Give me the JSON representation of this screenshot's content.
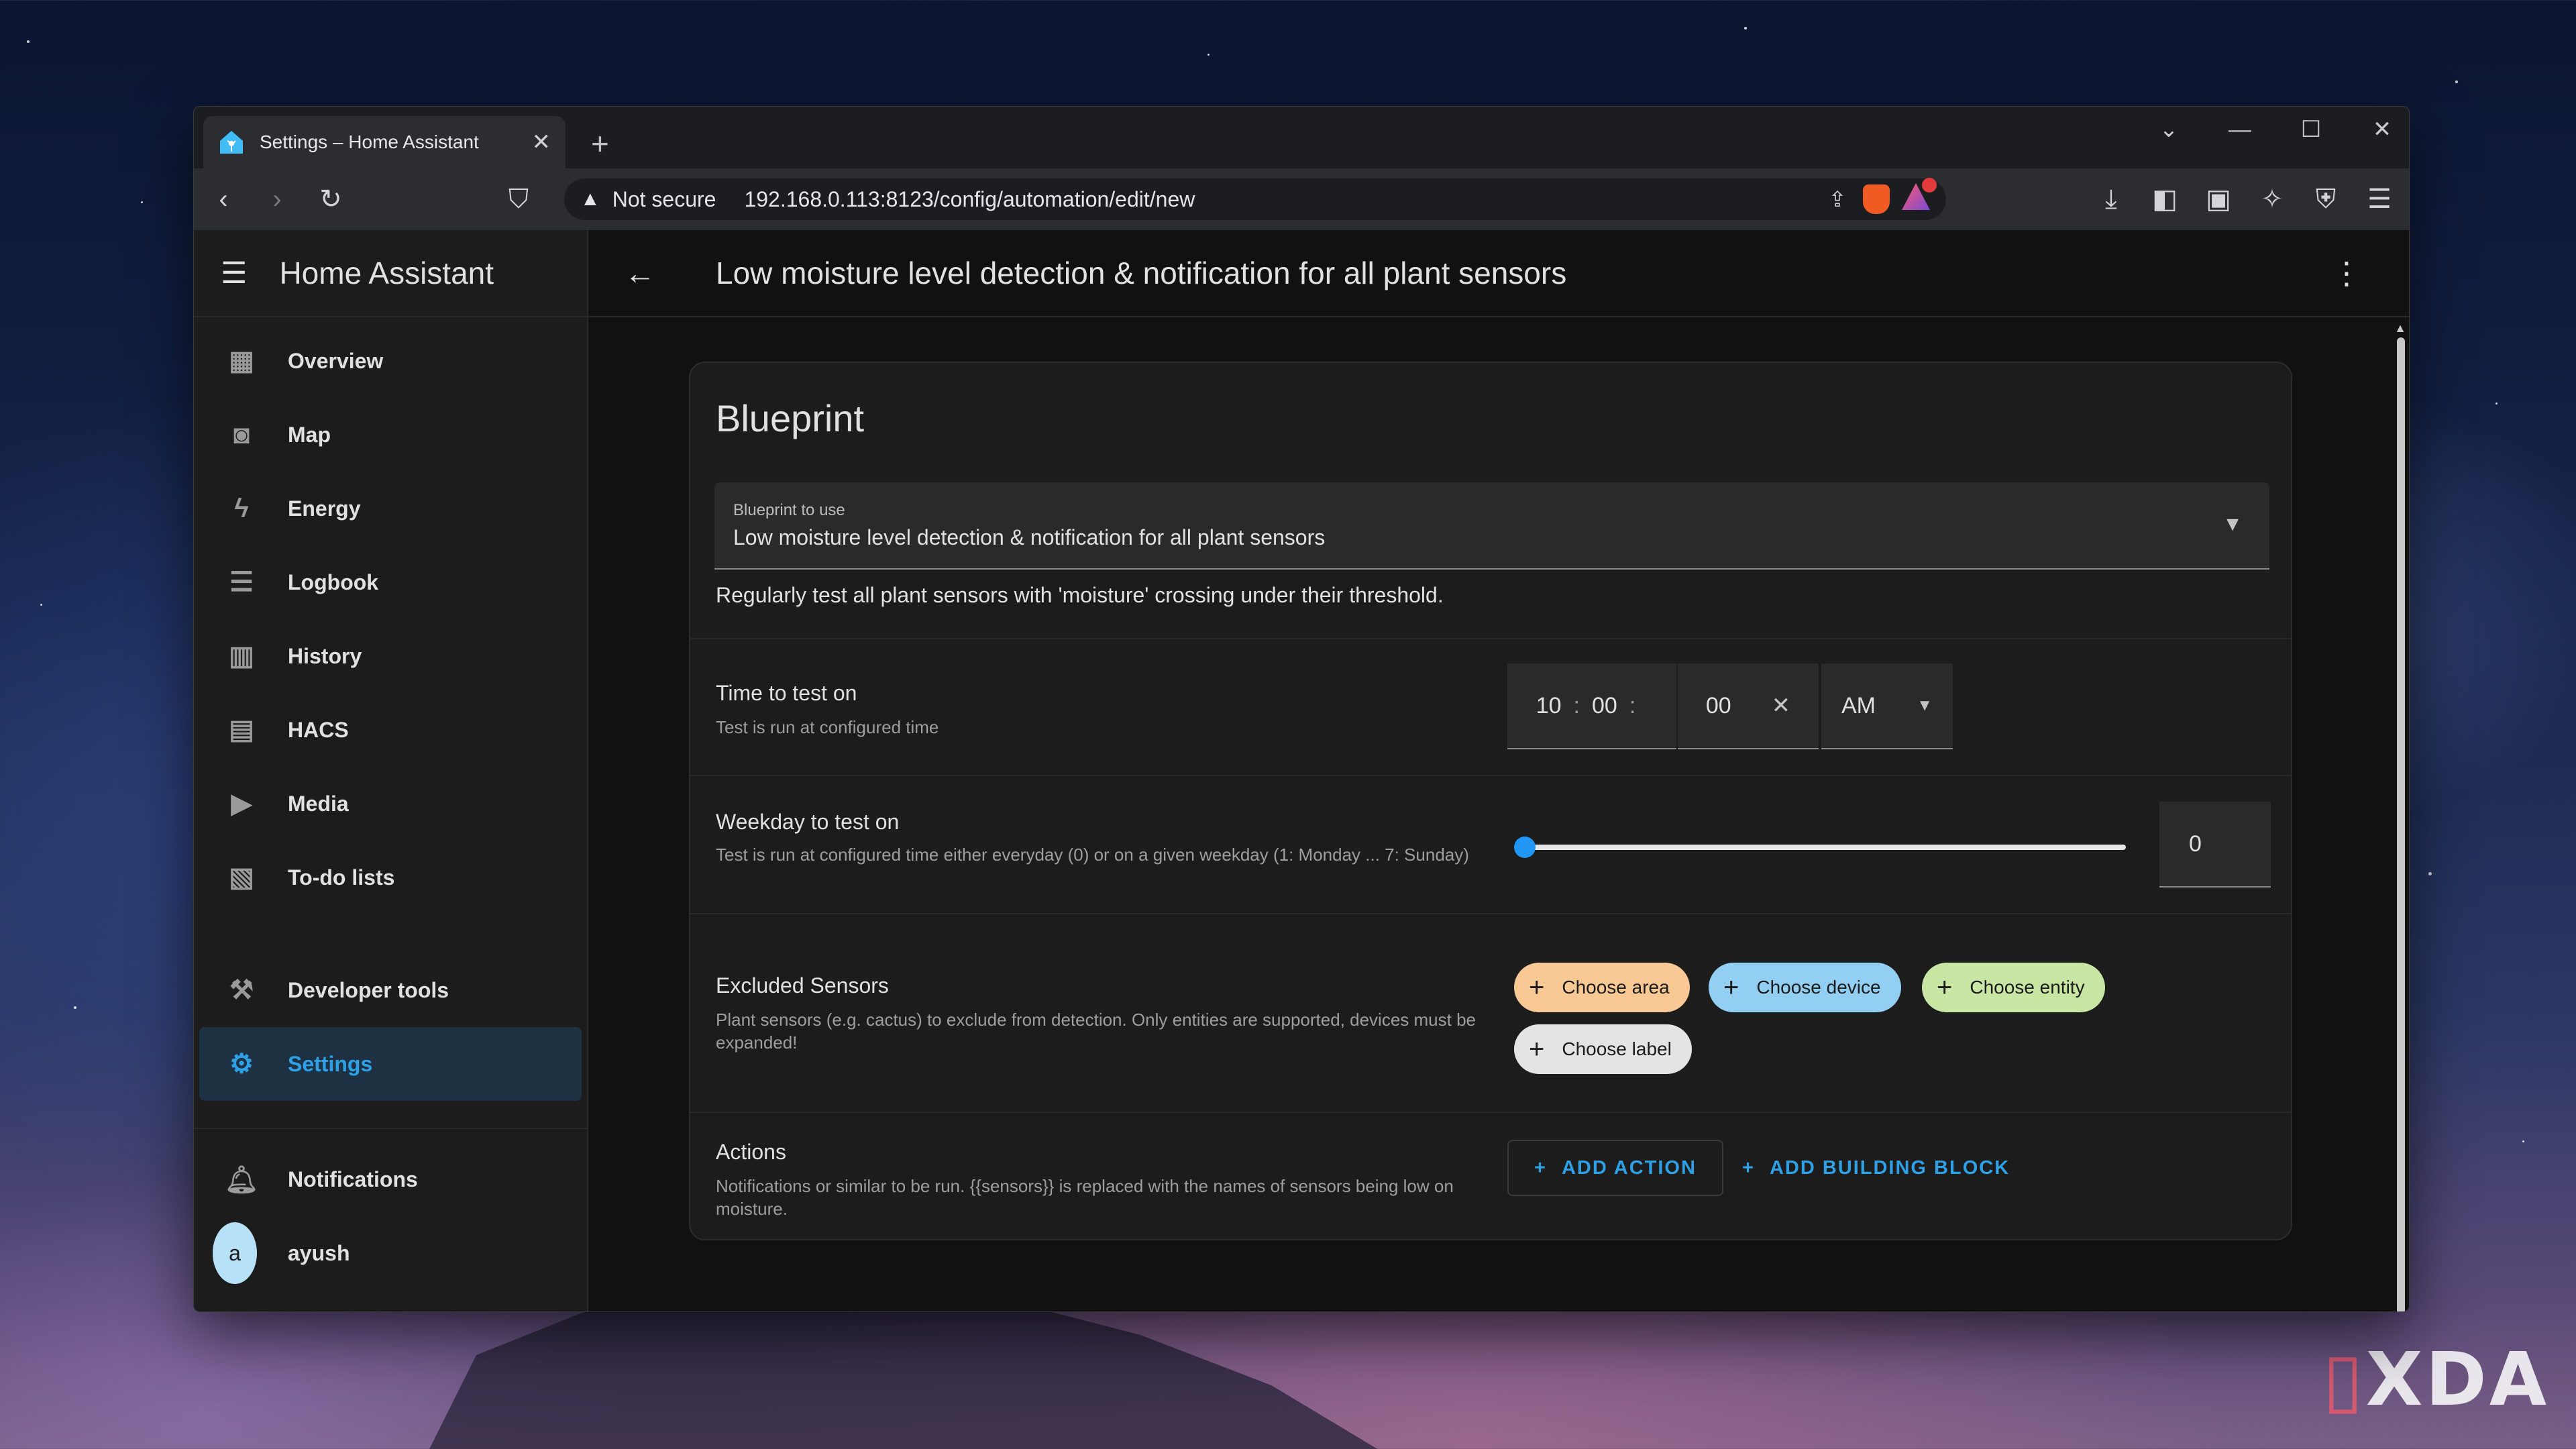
{
  "browser": {
    "tab_title": "Settings – Home Assistant",
    "tab_close": "✕",
    "new_tab": "+",
    "security_label": "Not secure",
    "url": "192.168.0.113:8123/config/automation/edit/new"
  },
  "watermark": "XDA",
  "sidebar": {
    "title": "Home Assistant",
    "items": [
      {
        "label": "Overview",
        "icon": "dashboard-icon"
      },
      {
        "label": "Map",
        "icon": "map-icon"
      },
      {
        "label": "Energy",
        "icon": "lightning-icon"
      },
      {
        "label": "Logbook",
        "icon": "list-icon"
      },
      {
        "label": "History",
        "icon": "chart-icon"
      },
      {
        "label": "HACS",
        "icon": "hacs-icon"
      },
      {
        "label": "Media",
        "icon": "media-icon"
      },
      {
        "label": "To-do lists",
        "icon": "clipboard-icon"
      }
    ],
    "developer_tools": "Developer tools",
    "settings": "Settings",
    "notifications": "Notifications",
    "user_initial": "a",
    "user_name": "ayush"
  },
  "page": {
    "title": "Low moisture level detection & notification for all plant sensors"
  },
  "blueprint": {
    "heading": "Blueprint",
    "select_label": "Blueprint to use",
    "select_value": "Low moisture level detection & notification for all plant sensors",
    "description": "Regularly test all plant sensors with 'moisture' crossing under their threshold."
  },
  "time_row": {
    "title": "Time to test on",
    "desc": "Test is run at configured time",
    "hours": "10",
    "minutes": "00",
    "seconds": "00",
    "separator": ":",
    "ampm": "AM"
  },
  "weekday_row": {
    "title": "Weekday to test on",
    "desc": "Test is run at configured time either everyday (0) or on a given weekday (1: Monday ... 7: Sunday)",
    "value": "0",
    "slider_fraction": 0
  },
  "excluded_row": {
    "title": "Excluded Sensors",
    "desc": "Plant sensors (e.g. cactus) to exclude from detection. Only entities are supported, devices must be expanded!",
    "chips": {
      "area": "Choose area",
      "device": "Choose device",
      "entity": "Choose entity",
      "label": "Choose label"
    },
    "colors": {
      "area": "#f9c995",
      "device": "#92cff2",
      "entity": "#c9e6a5",
      "label": "#e4e4e4"
    }
  },
  "actions_row": {
    "title": "Actions",
    "desc": "Notifications or similar to be run. {{sensors}} is replaced with the names of sensors being low on moisture.",
    "add_action": "ADD ACTION",
    "add_block": "ADD BUILDING BLOCK"
  },
  "colors": {
    "accent": "#2ea0e6",
    "active_bg": "#1d3143"
  }
}
